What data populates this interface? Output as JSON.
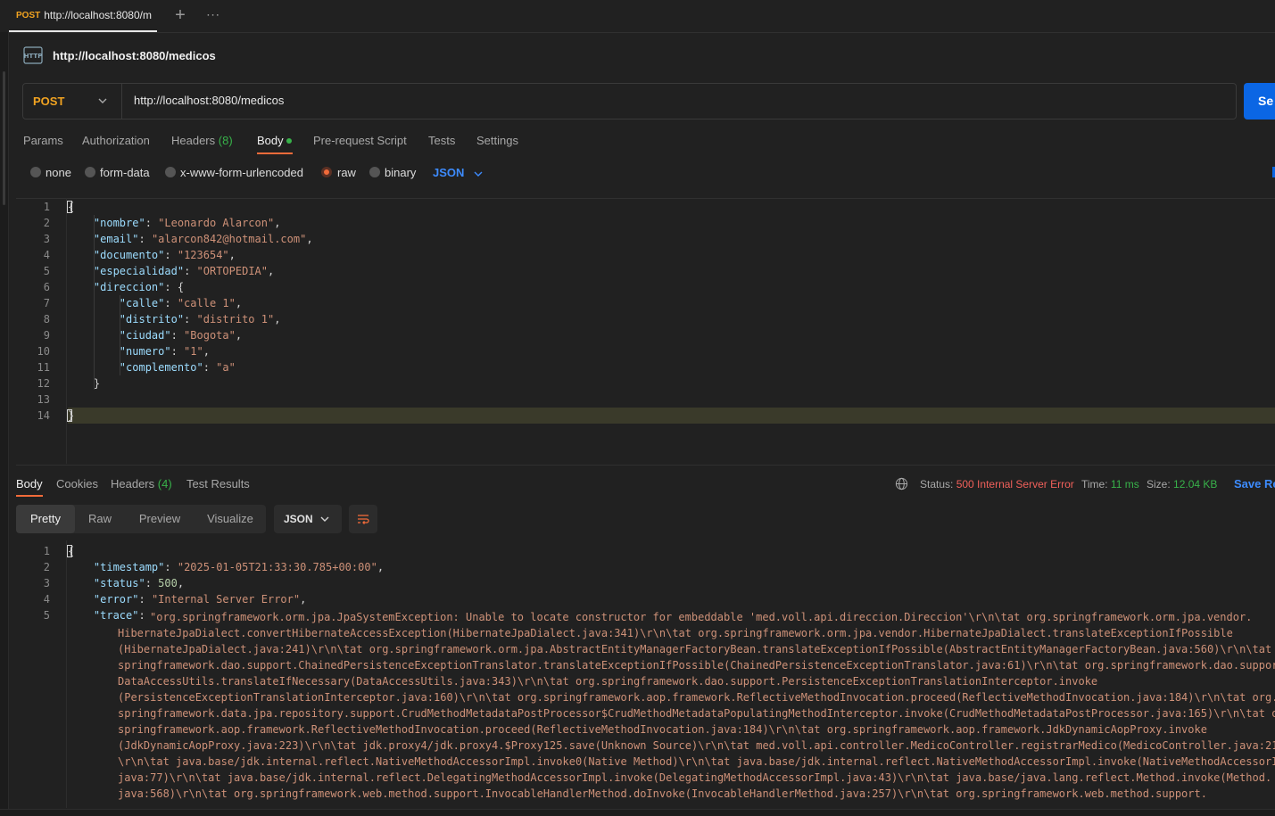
{
  "tab": {
    "method": "POST",
    "url": "http://localhost:8080/m"
  },
  "tabbar": {
    "new_tab": "+",
    "more": "∙∙∙"
  },
  "request": {
    "title": "http://localhost:8080/medicos",
    "method": "POST",
    "url": "http://localhost:8080/medicos",
    "send_label": "Se"
  },
  "req_tabs": {
    "params": "Params",
    "authorization": "Authorization",
    "headers": "Headers",
    "headers_count": "(8)",
    "body": "Body",
    "prerequest": "Pre-request Script",
    "tests": "Tests",
    "settings": "Settings"
  },
  "body_types": {
    "none": "none",
    "form_data": "form-data",
    "urlencoded": "x-www-form-urlencoded",
    "raw": "raw",
    "binary": "binary",
    "format": "JSON"
  },
  "request_body": {
    "line_numbers": [
      "1",
      "2",
      "3",
      "4",
      "5",
      "6",
      "7",
      "8",
      "9",
      "10",
      "11",
      "12",
      "13",
      "14"
    ],
    "nombre_key": "\"nombre\"",
    "nombre_val": "\"Leonardo Alarcon\"",
    "email_key": "\"email\"",
    "email_val": "\"alarcon842@hotmail.com\"",
    "documento_key": "\"documento\"",
    "documento_val": "\"123654\"",
    "especialidad_key": "\"especialidad\"",
    "especialidad_val": "\"ORTOPEDIA\"",
    "direccion_key": "\"direccion\"",
    "calle_key": "\"calle\"",
    "calle_val": "\"calle 1\"",
    "distrito_key": "\"distrito\"",
    "distrito_val": "\"distrito 1\"",
    "ciudad_key": "\"ciudad\"",
    "ciudad_val": "\"Bogota\"",
    "numero_key": "\"numero\"",
    "numero_val": "\"1\"",
    "complemento_key": "\"complemento\"",
    "complemento_val": "\"a\""
  },
  "resp_tabs": {
    "body": "Body",
    "cookies": "Cookies",
    "headers": "Headers",
    "headers_count": "(4)",
    "test_results": "Test Results"
  },
  "status": {
    "status_label": "Status:",
    "status_value": "500 Internal Server Error",
    "time_label": "Time:",
    "time_value": "11 ms",
    "size_label": "Size:",
    "size_value": "12.04 KB",
    "save_response": "Save Re"
  },
  "view": {
    "pretty": "Pretty",
    "raw": "Raw",
    "preview": "Preview",
    "visualize": "Visualize",
    "format": "JSON"
  },
  "response_body": {
    "line_numbers": [
      "1",
      "2",
      "3",
      "4",
      "5"
    ],
    "timestamp_key": "\"timestamp\"",
    "timestamp_val": "\"2025-01-05T21:33:30.785+00:00\"",
    "status_key": "\"status\"",
    "status_val": "500",
    "error_key": "\"error\"",
    "error_val": "\"Internal Server Error\"",
    "trace_key": "\"trace\"",
    "trace_lines": [
      "\"org.springframework.orm.jpa.JpaSystemException: Unable to locate constructor for embeddable 'med.voll.api.direccion.Direccion'\\r\\n\\tat org.springframework.orm.jpa.vendor.",
      "HibernateJpaDialect.convertHibernateAccessException(HibernateJpaDialect.java:341)\\r\\n\\tat org.springframework.orm.jpa.vendor.HibernateJpaDialect.translateExceptionIfPossible",
      "(HibernateJpaDialect.java:241)\\r\\n\\tat org.springframework.orm.jpa.AbstractEntityManagerFactoryBean.translateExceptionIfPossible(AbstractEntityManagerFactoryBean.java:560)\\r\\n\\tat org.",
      "springframework.dao.support.ChainedPersistenceExceptionTranslator.translateExceptionIfPossible(ChainedPersistenceExceptionTranslator.java:61)\\r\\n\\tat org.springframework.dao.support.",
      "DataAccessUtils.translateIfNecessary(DataAccessUtils.java:343)\\r\\n\\tat org.springframework.dao.support.PersistenceExceptionTranslationInterceptor.invoke",
      "(PersistenceExceptionTranslationInterceptor.java:160)\\r\\n\\tat org.springframework.aop.framework.ReflectiveMethodInvocation.proceed(ReflectiveMethodInvocation.java:184)\\r\\n\\tat org.",
      "springframework.data.jpa.repository.support.CrudMethodMetadataPostProcessor$CrudMethodMetadataPopulatingMethodInterceptor.invoke(CrudMethodMetadataPostProcessor.java:165)\\r\\n\\tat org.",
      "springframework.aop.framework.ReflectiveMethodInvocation.proceed(ReflectiveMethodInvocation.java:184)\\r\\n\\tat org.springframework.aop.framework.JdkDynamicAopProxy.invoke",
      "(JdkDynamicAopProxy.java:223)\\r\\n\\tat jdk.proxy4/jdk.proxy4.$Proxy125.save(Unknown Source)\\r\\n\\tat med.voll.api.controller.MedicoController.registrarMedico(MedicoController.java:21",
      "\\r\\n\\tat java.base/jdk.internal.reflect.NativeMethodAccessorImpl.invoke0(Native Method)\\r\\n\\tat java.base/jdk.internal.reflect.NativeMethodAccessorImpl.invoke(NativeMethodAccessorIm",
      "java:77)\\r\\n\\tat java.base/jdk.internal.reflect.DelegatingMethodAccessorImpl.invoke(DelegatingMethodAccessorImpl.java:43)\\r\\n\\tat java.base/java.lang.reflect.Method.invoke(Method.",
      "java:568)\\r\\n\\tat org.springframework.web.method.support.InvocableHandlerMethod.doInvoke(InvocableHandlerMethod.java:257)\\r\\n\\tat org.springframework.web.method.support."
    ]
  },
  "colors": {
    "accent_orange": "#f26b3a",
    "post_method": "#f1a321",
    "send_blue": "#0b66e4",
    "status_error": "#f0605a",
    "success_green": "#38b24a"
  },
  "icons": {
    "http": "http-icon",
    "chevron": "chevron-down-icon",
    "globe": "globe-icon",
    "wrap": "wrap-lines-icon"
  }
}
